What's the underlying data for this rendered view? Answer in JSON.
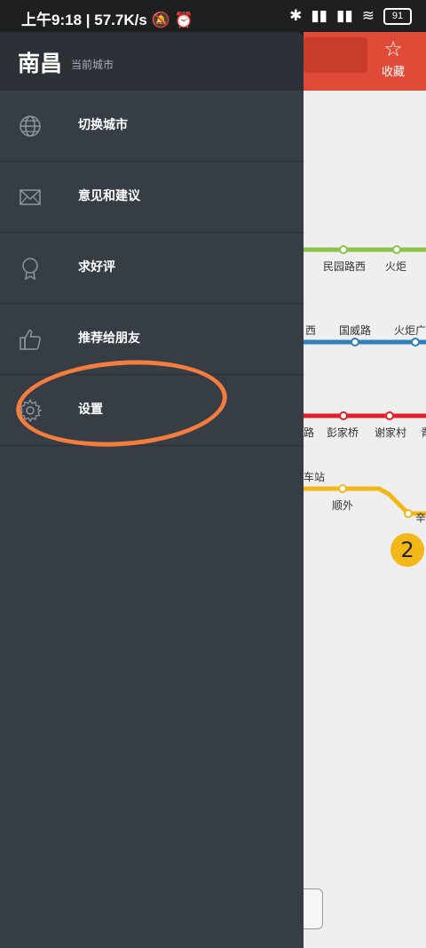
{
  "status_bar": {
    "time": "上午9:18",
    "speed": "57.7K/s",
    "battery": "91"
  },
  "drawer": {
    "city": "南昌",
    "city_subtitle": "当前城市",
    "menu_items": [
      {
        "label": "切换城市",
        "icon": "globe-icon"
      },
      {
        "label": "意见和建议",
        "icon": "envelope-icon"
      },
      {
        "label": "求好评",
        "icon": "award-badge-icon"
      },
      {
        "label": "推荐给朋友",
        "icon": "thumbs-up-icon"
      },
      {
        "label": "设置",
        "icon": "gear-icon"
      }
    ]
  },
  "map": {
    "favorite_label": "收藏",
    "stations": {
      "green_1": "民园路西",
      "green_2": "火炬",
      "blue_1": "西",
      "blue_2": "国威路",
      "blue_3": "火炬广",
      "red_1": "路",
      "red_2": "彭家桥",
      "red_3": "谢家村",
      "red_4": "青",
      "yellow_station": "车站",
      "yellow_1": "顺外",
      "yellow_2": "辛"
    },
    "line_badge": "2",
    "line_colors": {
      "green": "#8bc34a",
      "blue": "#2f7fb8",
      "red": "#e0202a",
      "yellow": "#f2b719"
    }
  },
  "annotation": {
    "highlight_color": "#f47d3e"
  }
}
